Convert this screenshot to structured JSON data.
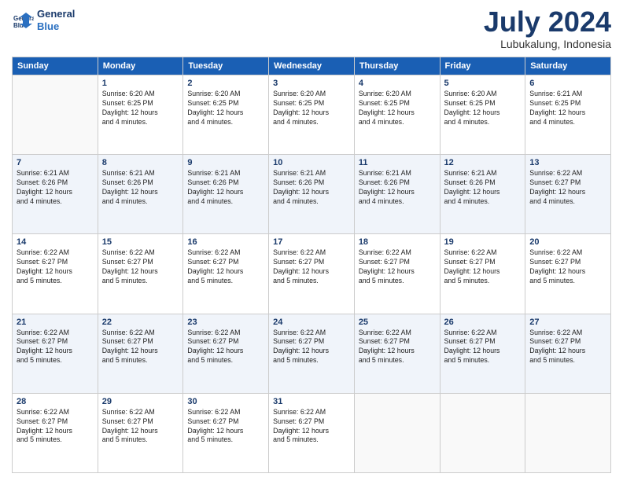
{
  "logo": {
    "line1": "General",
    "line2": "Blue"
  },
  "title": {
    "month_year": "July 2024",
    "location": "Lubukalung, Indonesia"
  },
  "headers": [
    "Sunday",
    "Monday",
    "Tuesday",
    "Wednesday",
    "Thursday",
    "Friday",
    "Saturday"
  ],
  "weeks": [
    [
      {
        "day": "",
        "info": ""
      },
      {
        "day": "1",
        "info": "Sunrise: 6:20 AM\nSunset: 6:25 PM\nDaylight: 12 hours\nand 4 minutes."
      },
      {
        "day": "2",
        "info": "Sunrise: 6:20 AM\nSunset: 6:25 PM\nDaylight: 12 hours\nand 4 minutes."
      },
      {
        "day": "3",
        "info": "Sunrise: 6:20 AM\nSunset: 6:25 PM\nDaylight: 12 hours\nand 4 minutes."
      },
      {
        "day": "4",
        "info": "Sunrise: 6:20 AM\nSunset: 6:25 PM\nDaylight: 12 hours\nand 4 minutes."
      },
      {
        "day": "5",
        "info": "Sunrise: 6:20 AM\nSunset: 6:25 PM\nDaylight: 12 hours\nand 4 minutes."
      },
      {
        "day": "6",
        "info": "Sunrise: 6:21 AM\nSunset: 6:25 PM\nDaylight: 12 hours\nand 4 minutes."
      }
    ],
    [
      {
        "day": "7",
        "info": "Sunrise: 6:21 AM\nSunset: 6:26 PM\nDaylight: 12 hours\nand 4 minutes."
      },
      {
        "day": "8",
        "info": "Sunrise: 6:21 AM\nSunset: 6:26 PM\nDaylight: 12 hours\nand 4 minutes."
      },
      {
        "day": "9",
        "info": "Sunrise: 6:21 AM\nSunset: 6:26 PM\nDaylight: 12 hours\nand 4 minutes."
      },
      {
        "day": "10",
        "info": "Sunrise: 6:21 AM\nSunset: 6:26 PM\nDaylight: 12 hours\nand 4 minutes."
      },
      {
        "day": "11",
        "info": "Sunrise: 6:21 AM\nSunset: 6:26 PM\nDaylight: 12 hours\nand 4 minutes."
      },
      {
        "day": "12",
        "info": "Sunrise: 6:21 AM\nSunset: 6:26 PM\nDaylight: 12 hours\nand 4 minutes."
      },
      {
        "day": "13",
        "info": "Sunrise: 6:22 AM\nSunset: 6:27 PM\nDaylight: 12 hours\nand 4 minutes."
      }
    ],
    [
      {
        "day": "14",
        "info": "Sunrise: 6:22 AM\nSunset: 6:27 PM\nDaylight: 12 hours\nand 5 minutes."
      },
      {
        "day": "15",
        "info": "Sunrise: 6:22 AM\nSunset: 6:27 PM\nDaylight: 12 hours\nand 5 minutes."
      },
      {
        "day": "16",
        "info": "Sunrise: 6:22 AM\nSunset: 6:27 PM\nDaylight: 12 hours\nand 5 minutes."
      },
      {
        "day": "17",
        "info": "Sunrise: 6:22 AM\nSunset: 6:27 PM\nDaylight: 12 hours\nand 5 minutes."
      },
      {
        "day": "18",
        "info": "Sunrise: 6:22 AM\nSunset: 6:27 PM\nDaylight: 12 hours\nand 5 minutes."
      },
      {
        "day": "19",
        "info": "Sunrise: 6:22 AM\nSunset: 6:27 PM\nDaylight: 12 hours\nand 5 minutes."
      },
      {
        "day": "20",
        "info": "Sunrise: 6:22 AM\nSunset: 6:27 PM\nDaylight: 12 hours\nand 5 minutes."
      }
    ],
    [
      {
        "day": "21",
        "info": "Sunrise: 6:22 AM\nSunset: 6:27 PM\nDaylight: 12 hours\nand 5 minutes."
      },
      {
        "day": "22",
        "info": "Sunrise: 6:22 AM\nSunset: 6:27 PM\nDaylight: 12 hours\nand 5 minutes."
      },
      {
        "day": "23",
        "info": "Sunrise: 6:22 AM\nSunset: 6:27 PM\nDaylight: 12 hours\nand 5 minutes."
      },
      {
        "day": "24",
        "info": "Sunrise: 6:22 AM\nSunset: 6:27 PM\nDaylight: 12 hours\nand 5 minutes."
      },
      {
        "day": "25",
        "info": "Sunrise: 6:22 AM\nSunset: 6:27 PM\nDaylight: 12 hours\nand 5 minutes."
      },
      {
        "day": "26",
        "info": "Sunrise: 6:22 AM\nSunset: 6:27 PM\nDaylight: 12 hours\nand 5 minutes."
      },
      {
        "day": "27",
        "info": "Sunrise: 6:22 AM\nSunset: 6:27 PM\nDaylight: 12 hours\nand 5 minutes."
      }
    ],
    [
      {
        "day": "28",
        "info": "Sunrise: 6:22 AM\nSunset: 6:27 PM\nDaylight: 12 hours\nand 5 minutes."
      },
      {
        "day": "29",
        "info": "Sunrise: 6:22 AM\nSunset: 6:27 PM\nDaylight: 12 hours\nand 5 minutes."
      },
      {
        "day": "30",
        "info": "Sunrise: 6:22 AM\nSunset: 6:27 PM\nDaylight: 12 hours\nand 5 minutes."
      },
      {
        "day": "31",
        "info": "Sunrise: 6:22 AM\nSunset: 6:27 PM\nDaylight: 12 hours\nand 5 minutes."
      },
      {
        "day": "",
        "info": ""
      },
      {
        "day": "",
        "info": ""
      },
      {
        "day": "",
        "info": ""
      }
    ]
  ]
}
